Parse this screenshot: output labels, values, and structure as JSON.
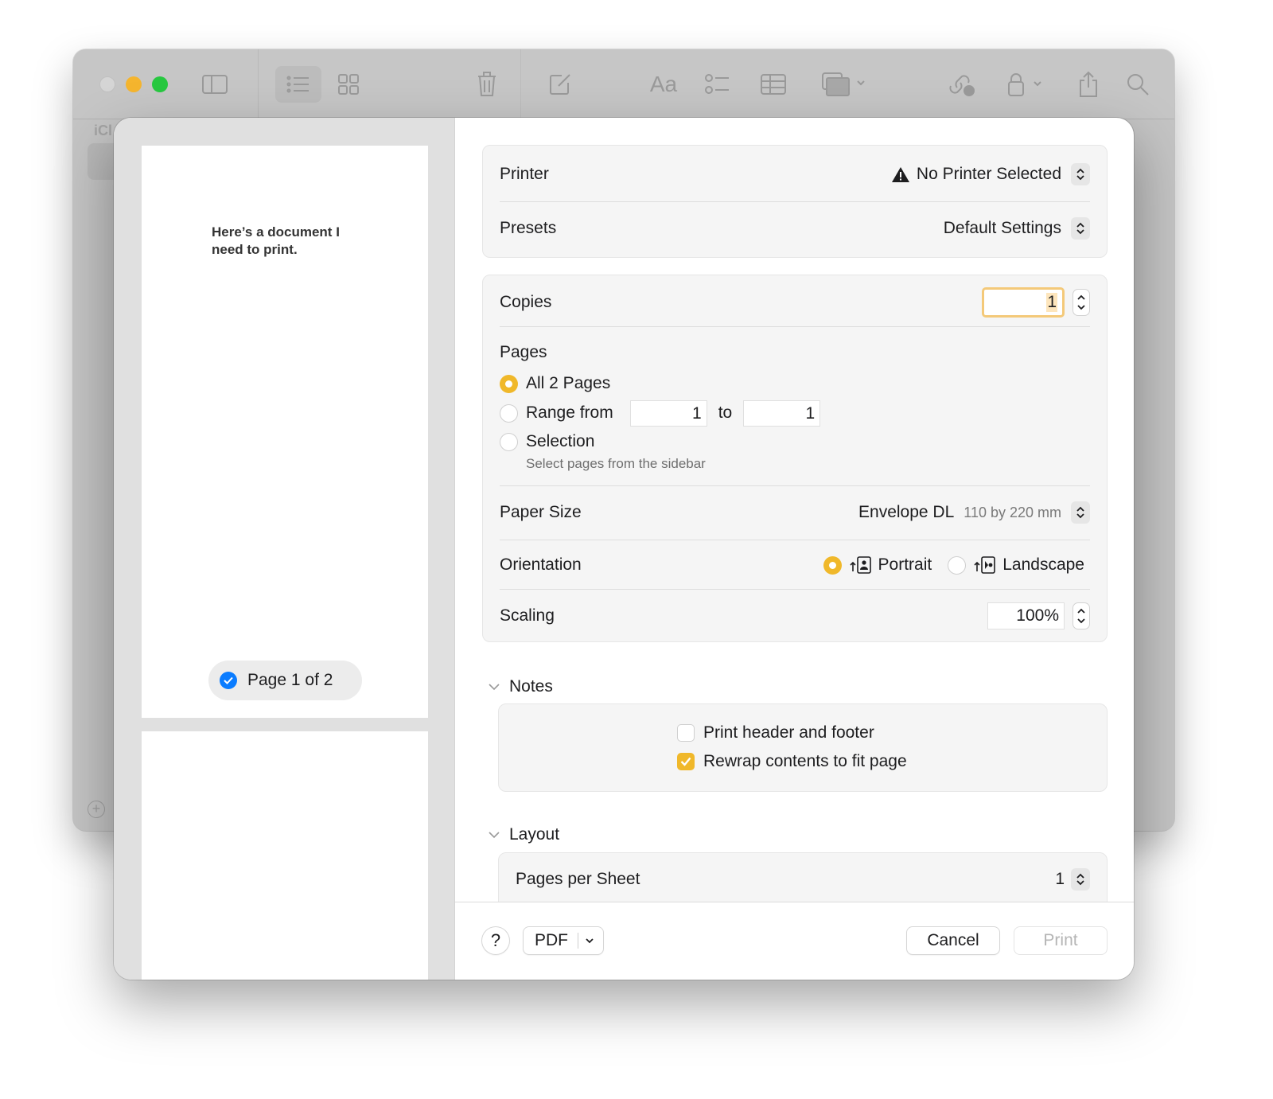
{
  "app": {
    "sidebar_label": "iCl",
    "toolbar_icons": [
      "sidebar-toggle-icon",
      "list-view-icon",
      "gallery-view-icon",
      "trash-icon",
      "compose-icon",
      "format-text-icon",
      "checklist-icon",
      "table-icon",
      "media-icon",
      "collaborate-icon",
      "lock-icon",
      "share-icon",
      "search-icon"
    ],
    "format_label": "Aa"
  },
  "preview": {
    "page_text": "Here’s a document I need to print.",
    "page_badge": "Page 1 of 2",
    "page_badge_checked": true
  },
  "printer": {
    "label": "Printer",
    "value": "No Printer Selected",
    "warning": true
  },
  "presets": {
    "label": "Presets",
    "value": "Default Settings"
  },
  "copies": {
    "label": "Copies",
    "value": "1"
  },
  "pages": {
    "label": "Pages",
    "options": [
      {
        "label": "All 2 Pages",
        "selected": true
      },
      {
        "label": "Range from",
        "selected": false
      },
      {
        "label": "Selection",
        "selected": false
      }
    ],
    "range_from": "1",
    "range_to_label": "to",
    "range_to": "1",
    "selection_hint": "Select pages from the sidebar"
  },
  "paper_size": {
    "label": "Paper Size",
    "value": "Envelope DL",
    "dimensions": "110 by 220 mm"
  },
  "orientation": {
    "label": "Orientation",
    "options": [
      {
        "label": "Portrait",
        "selected": true
      },
      {
        "label": "Landscape",
        "selected": false
      }
    ]
  },
  "scaling": {
    "label": "Scaling",
    "value": "100%"
  },
  "notes_section": {
    "title": "Notes",
    "expanded": true,
    "options": [
      {
        "label": "Print header and footer",
        "checked": false
      },
      {
        "label": "Rewrap contents to fit page",
        "checked": true
      }
    ]
  },
  "layout_section": {
    "title": "Layout",
    "expanded": true,
    "pages_per_sheet_label": "Pages per Sheet",
    "pages_per_sheet_value": "1"
  },
  "footer": {
    "help_label": "?",
    "pdf_label": "PDF",
    "cancel_label": "Cancel",
    "print_label": "Print",
    "print_enabled": false
  },
  "colors": {
    "accent": "#f0b82a",
    "focus_ring": "#f4c979",
    "checkmark_blue": "#0a7cff",
    "traffic_min": "#f5b52e",
    "traffic_max": "#27c840"
  }
}
